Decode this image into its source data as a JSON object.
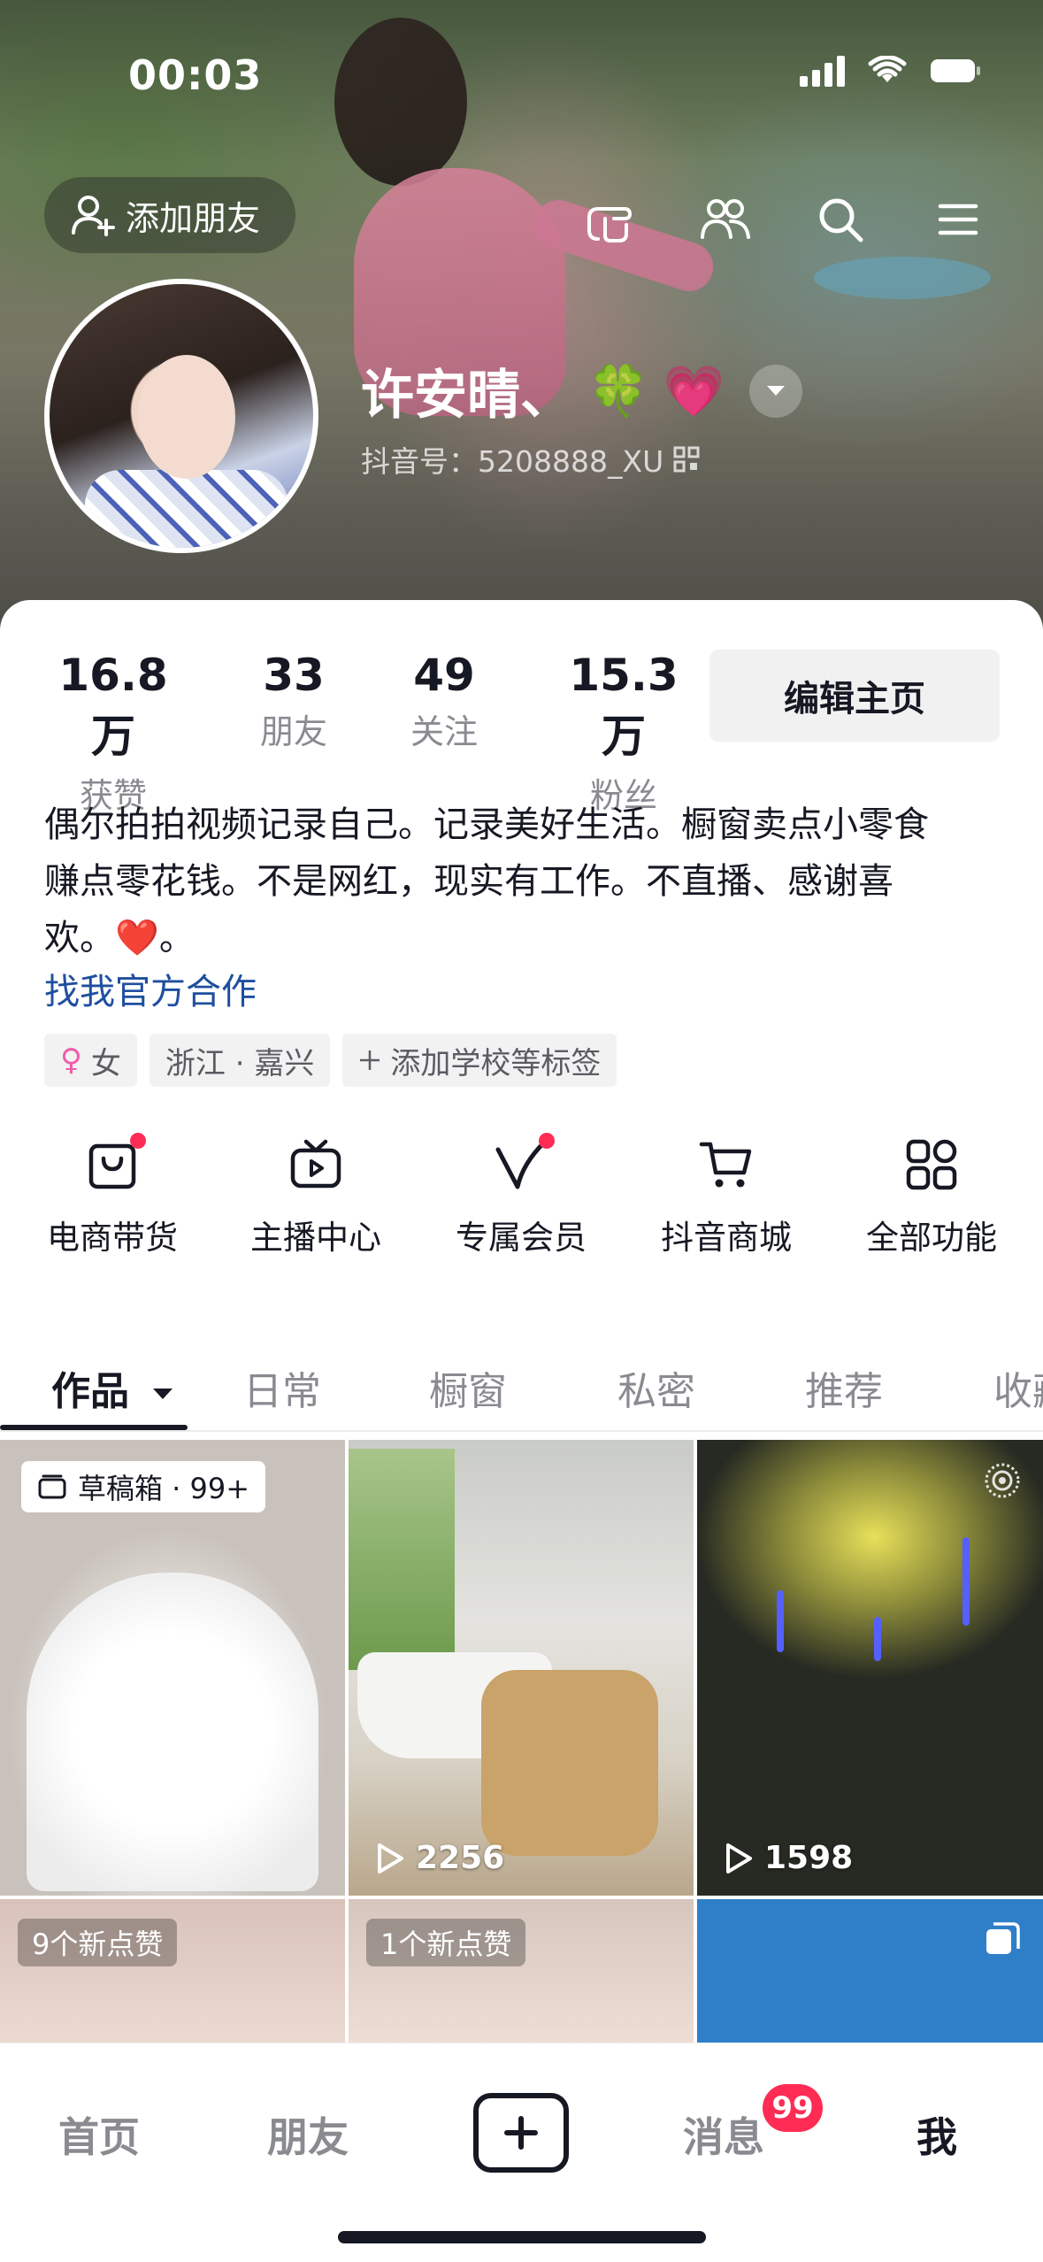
{
  "status_bar": {
    "time": "00:03"
  },
  "header": {
    "add_friend_label": "添加朋友",
    "nickname": "许安晴、",
    "nickname_emojis": [
      "🍀",
      "💗"
    ],
    "douyin_id": "抖音号：5208888_XU"
  },
  "stats": [
    {
      "value": "16.8万",
      "label": "获赞"
    },
    {
      "value": "33",
      "label": "朋友"
    },
    {
      "value": "49",
      "label": "关注"
    },
    {
      "value": "15.3万",
      "label": "粉丝"
    }
  ],
  "edit_button": "编辑主页",
  "bio": {
    "line1": "偶尔拍拍视频记录自己。记录美好生活。橱窗卖点小零食",
    "line2": "赚点零花钱。不是网红，现实有工作。不直播、感谢喜",
    "line3_text": "欢。",
    "line3_emoji": "❤️",
    "line3_end": "。",
    "link": "找我官方合作"
  },
  "tags": [
    {
      "icon": "female-icon",
      "label": "女"
    },
    {
      "label": "浙江 · 嘉兴"
    },
    {
      "icon": "plus-icon",
      "label": "添加学校等标签"
    }
  ],
  "shortcuts": [
    {
      "icon": "shopping-bag-icon",
      "label": "电商带货",
      "dot": true
    },
    {
      "icon": "live-tv-icon",
      "label": "主播中心",
      "dot": false
    },
    {
      "icon": "vip-v-icon",
      "label": "专属会员",
      "dot": true
    },
    {
      "icon": "cart-icon",
      "label": "抖音商城",
      "dot": false
    },
    {
      "icon": "grid-apps-icon",
      "label": "全部功能",
      "dot": false
    }
  ],
  "tabs": [
    "作品",
    "日常",
    "橱窗",
    "私密",
    "推荐",
    "收藏"
  ],
  "active_tab": "作品",
  "videos": [
    {
      "badge": "草稿箱 · 99+"
    },
    {
      "plays": "2256"
    },
    {
      "plays": "1598"
    },
    {
      "new_likes": "9个新点赞"
    },
    {
      "new_likes": "1个新点赞"
    },
    {}
  ],
  "bottom_nav": {
    "home": "首页",
    "friends": "朋友",
    "messages": "消息",
    "messages_badge": "99",
    "me": "我"
  },
  "colors": {
    "accent": "#fe2c55",
    "text": "#161823",
    "link": "#1f4f9e",
    "muted": "#8a8b91"
  }
}
